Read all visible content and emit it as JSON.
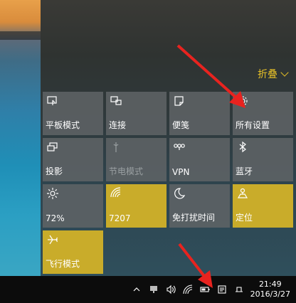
{
  "action_center": {
    "collapse_label": "折叠",
    "tiles": [
      {
        "label": "平板模式",
        "icon": "tablet-mode-icon",
        "state": "off"
      },
      {
        "label": "连接",
        "icon": "connect-icon",
        "state": "off"
      },
      {
        "label": "便笺",
        "icon": "note-icon",
        "state": "off"
      },
      {
        "label": "所有设置",
        "icon": "settings-icon",
        "state": "off"
      },
      {
        "label": "投影",
        "icon": "project-icon",
        "state": "off"
      },
      {
        "label": "节电模式",
        "icon": "battery-saver-icon",
        "state": "disabled"
      },
      {
        "label": "VPN",
        "icon": "vpn-icon",
        "state": "off"
      },
      {
        "label": "蓝牙",
        "icon": "bluetooth-icon",
        "state": "off"
      },
      {
        "label": "72%",
        "icon": "brightness-icon",
        "state": "off"
      },
      {
        "label": "7207",
        "icon": "wifi-icon",
        "state": "on"
      },
      {
        "label": "免打扰时间",
        "icon": "quiet-hours-icon",
        "state": "off"
      },
      {
        "label": "定位",
        "icon": "location-icon",
        "state": "on"
      },
      {
        "label": "飞行模式",
        "icon": "airplane-icon",
        "state": "on"
      }
    ]
  },
  "taskbar": {
    "time": "21:49",
    "date": "2016/3/27",
    "tray_icons": [
      "chevron-up-icon",
      "network-icon",
      "volume-icon",
      "wifi-tray-icon",
      "battery-icon",
      "action-center-icon",
      "keyboard-icon"
    ]
  },
  "colors": {
    "accent": "#c9ac2a",
    "collapse_text": "#e6c027",
    "annotation_arrow": "#e8231f"
  }
}
